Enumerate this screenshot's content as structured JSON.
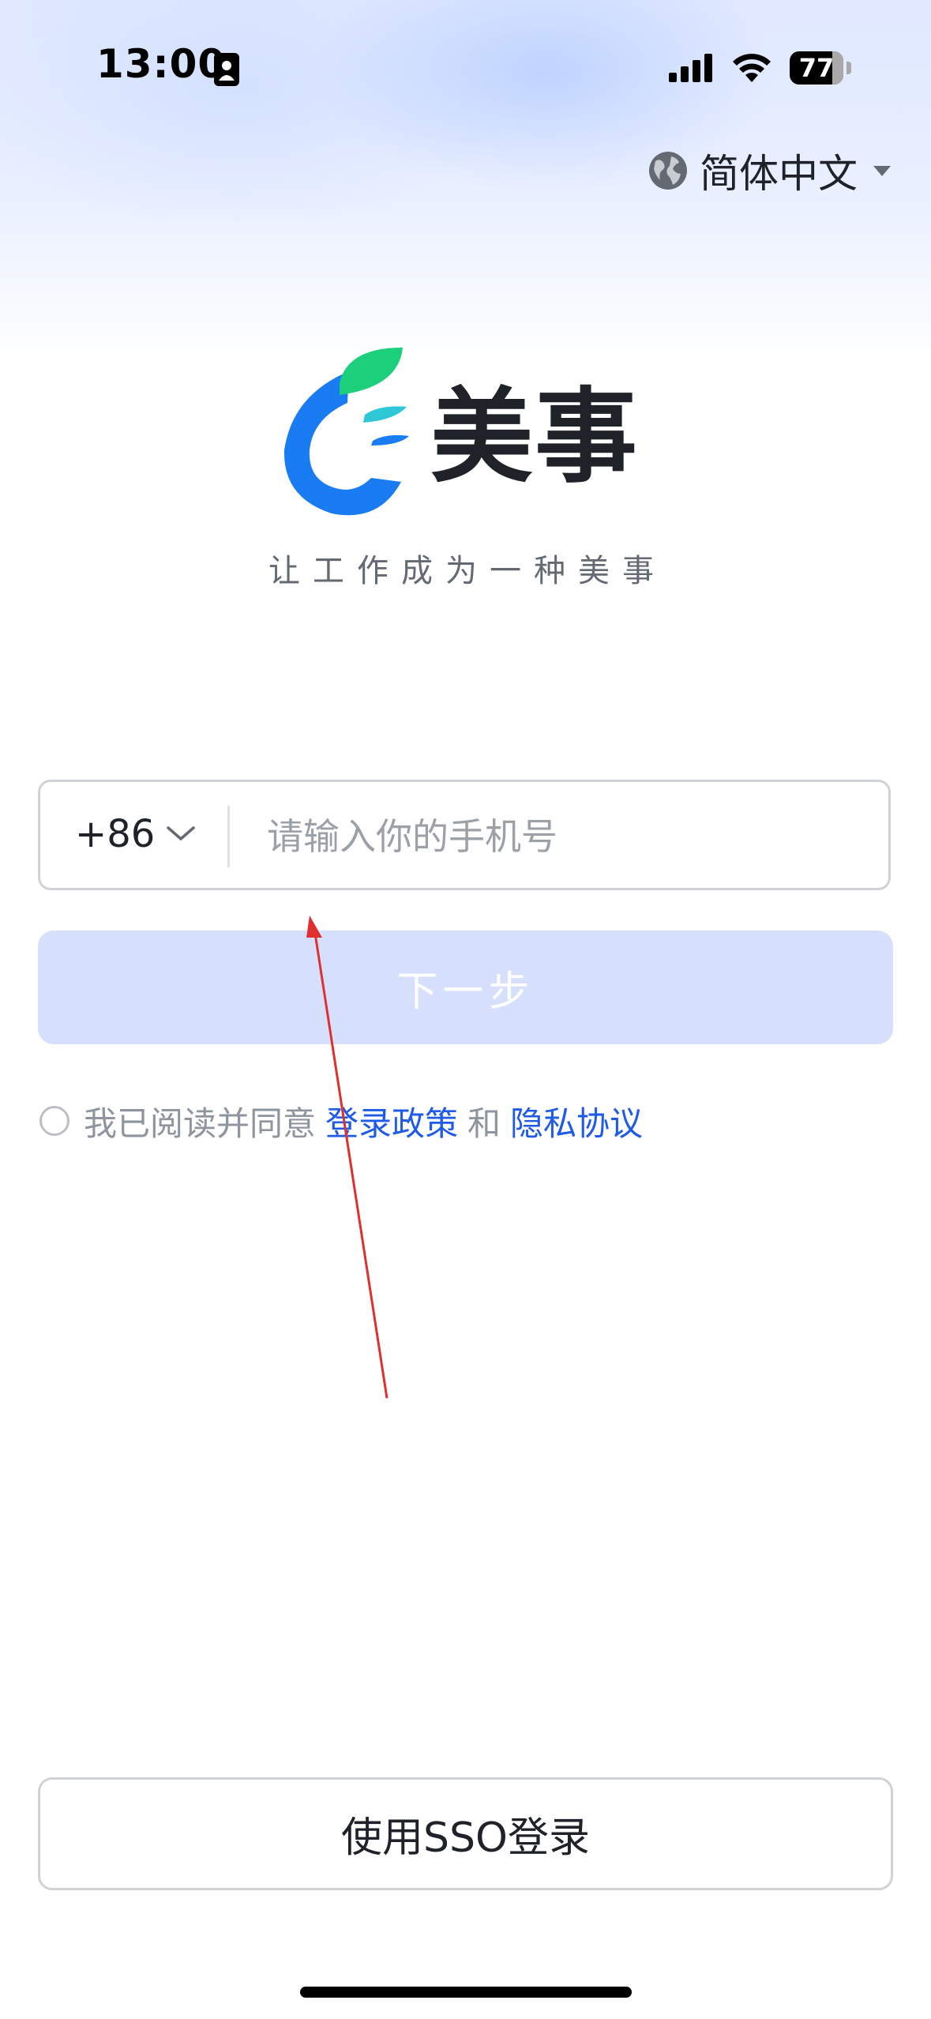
{
  "status_bar": {
    "time": "13:00",
    "battery": "77"
  },
  "language": {
    "label": "简体中文"
  },
  "brand": {
    "name": "美事",
    "slogan": "让工作成为一种美事"
  },
  "phone": {
    "country_code": "+86",
    "placeholder": "请输入你的手机号",
    "value": ""
  },
  "next_button": {
    "label": "下一步"
  },
  "agreement": {
    "prefix": "我已阅读并同意",
    "login_policy": "登录政策",
    "and": "和",
    "privacy_policy": "隐私协议"
  },
  "sso_button": {
    "label": "使用SSO登录"
  },
  "colors": {
    "accent": "#1f5be6",
    "button_disabled": "#d6e0fd",
    "logo_blue": "#1a7cf2",
    "logo_green": "#1ccf7a"
  }
}
